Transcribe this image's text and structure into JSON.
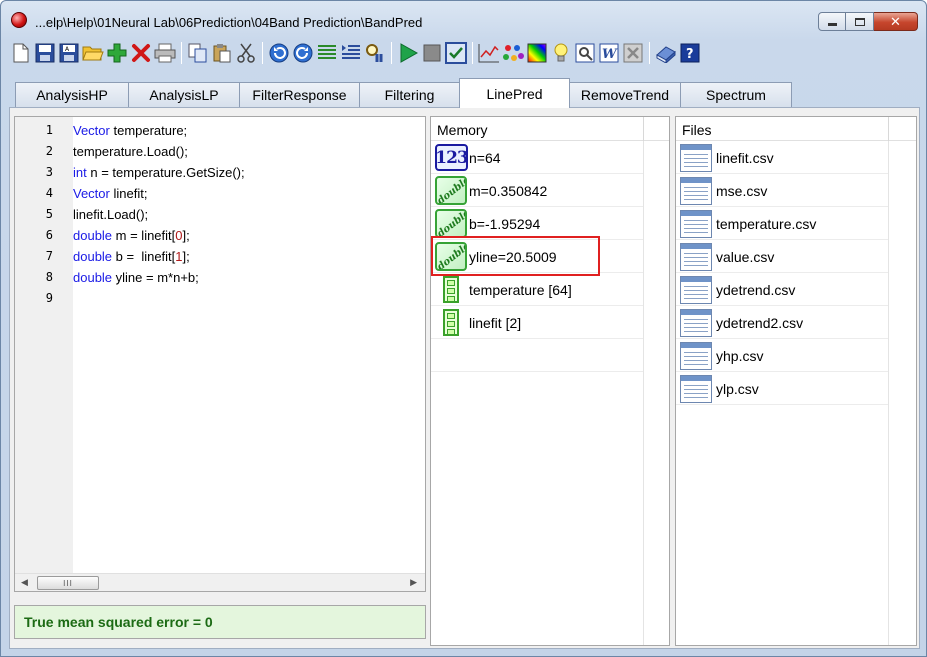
{
  "window": {
    "title": "...elp\\Help\\01Neural Lab\\06Prediction\\04Band Prediction\\BandPred",
    "close_label": "✕"
  },
  "toolbar": {
    "icons": [
      "new-file-icon",
      "save-icon",
      "save-as-icon",
      "open-folder-icon",
      "add-icon",
      "delete-icon",
      "print-icon",
      "copy-icon",
      "paste-icon",
      "cut-icon",
      "undo-icon",
      "redo-icon",
      "align-left-icon",
      "indent-icon",
      "find-icon",
      "run-icon",
      "stop-icon",
      "check-icon",
      "chart-icon",
      "palette-icon",
      "colormap-icon",
      "lightbulb-icon",
      "preview-icon",
      "word-icon",
      "excel-icon",
      "book-icon",
      "help-icon"
    ],
    "help_label": "?",
    "word_label": "W"
  },
  "tabs": [
    {
      "label": "AnalysisHP",
      "active": false
    },
    {
      "label": "AnalysisLP",
      "active": false
    },
    {
      "label": "FilterResponse",
      "active": false
    },
    {
      "label": "Filtering",
      "active": false
    },
    {
      "label": "LinePred",
      "active": true
    },
    {
      "label": "RemoveTrend",
      "active": false
    },
    {
      "label": "Spectrum",
      "active": false
    }
  ],
  "editor": {
    "lines": [
      {
        "num": "1",
        "parts": [
          {
            "t": "Vector",
            "c": "kw"
          },
          {
            "t": " temperature;",
            "c": ""
          }
        ]
      },
      {
        "num": "2",
        "parts": [
          {
            "t": "temperature.Load();",
            "c": ""
          }
        ]
      },
      {
        "num": "3",
        "parts": [
          {
            "t": "int",
            "c": "kw"
          },
          {
            "t": " n = temperature.GetSize();",
            "c": ""
          }
        ]
      },
      {
        "num": "4",
        "parts": [
          {
            "t": "Vector",
            "c": "kw"
          },
          {
            "t": " linefit;",
            "c": ""
          }
        ]
      },
      {
        "num": "5",
        "parts": [
          {
            "t": "linefit.Load();",
            "c": ""
          }
        ]
      },
      {
        "num": "6",
        "parts": [
          {
            "t": "double",
            "c": "kw"
          },
          {
            "t": " m = linefit[",
            "c": ""
          },
          {
            "t": "0",
            "c": "ix"
          },
          {
            "t": "];",
            "c": ""
          }
        ]
      },
      {
        "num": "7",
        "parts": [
          {
            "t": "double",
            "c": "kw"
          },
          {
            "t": " b =  linefit[",
            "c": ""
          },
          {
            "t": "1",
            "c": "ix"
          },
          {
            "t": "];",
            "c": ""
          }
        ]
      },
      {
        "num": "8",
        "parts": [
          {
            "t": "double",
            "c": "kw"
          },
          {
            "t": " yline = m*n+b;",
            "c": ""
          }
        ]
      },
      {
        "num": "9",
        "parts": []
      }
    ],
    "scroll_left": "◀",
    "scroll_right": "▶",
    "scroll_thumb": "III"
  },
  "status": {
    "text": "True mean squared error = 0"
  },
  "memory": {
    "header": "Memory",
    "items": [
      {
        "icon": "integer",
        "label": "n=64",
        "icon_text": "123"
      },
      {
        "icon": "double",
        "label": "m=0.350842",
        "icon_text": "double"
      },
      {
        "icon": "double",
        "label": "b=-1.95294",
        "icon_text": "double"
      },
      {
        "icon": "double",
        "label": "yline=20.5009",
        "icon_text": "double"
      },
      {
        "icon": "vector",
        "label": "temperature [64]"
      },
      {
        "icon": "vector",
        "label": "linefit [2]"
      }
    ]
  },
  "files": {
    "header": "Files",
    "items": [
      "linefit.csv",
      "mse.csv",
      "temperature.csv",
      "value.csv",
      "ydetrend.csv",
      "ydetrend2.csv",
      "yhp.csv",
      "ylp.csv"
    ]
  }
}
